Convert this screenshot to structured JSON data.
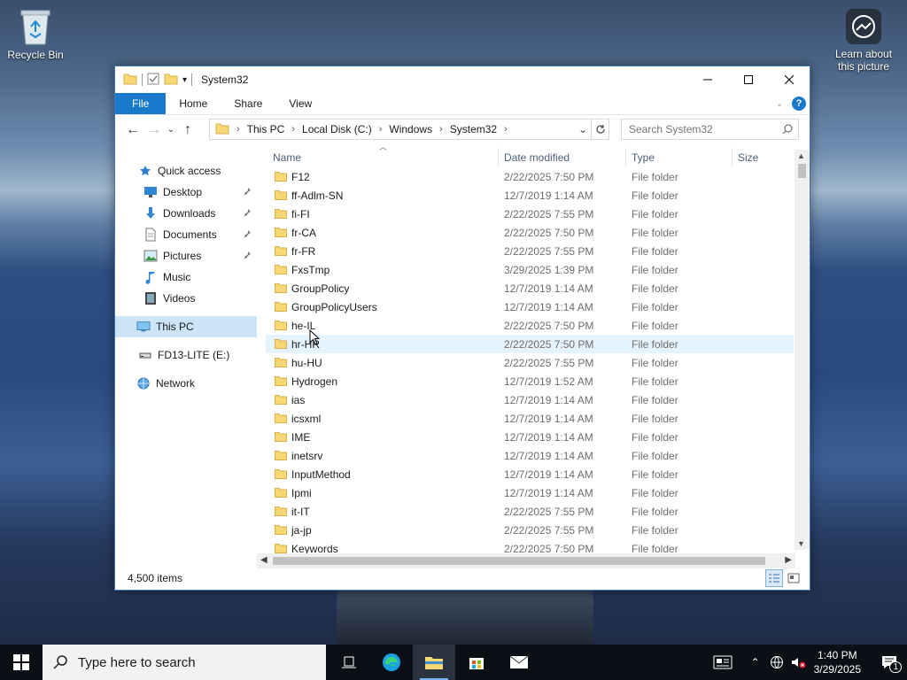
{
  "desktop": {
    "recycle_bin": "Recycle Bin",
    "learn_line1": "Learn about",
    "learn_line2": "this picture"
  },
  "window": {
    "title": "System32",
    "ribbon_tabs": [
      "File",
      "Home",
      "Share",
      "View"
    ],
    "address": {
      "crumbs": [
        "This PC",
        "Local Disk (C:)",
        "Windows",
        "System32"
      ]
    },
    "search_placeholder": "Search System32"
  },
  "nav_pane": {
    "quick_access": "Quick access",
    "items": [
      {
        "label": "Desktop",
        "icon": "desktop-icon",
        "pinned": true
      },
      {
        "label": "Downloads",
        "icon": "download-icon",
        "pinned": true
      },
      {
        "label": "Documents",
        "icon": "documents-icon",
        "pinned": true
      },
      {
        "label": "Pictures",
        "icon": "pictures-icon",
        "pinned": true
      },
      {
        "label": "Music",
        "icon": "music-icon",
        "pinned": false
      },
      {
        "label": "Videos",
        "icon": "videos-icon",
        "pinned": false
      }
    ],
    "this_pc": "This PC",
    "drive": "FD13-LITE (E:)",
    "network": "Network"
  },
  "columns": {
    "name": "Name",
    "date": "Date modified",
    "type": "Type",
    "size": "Size"
  },
  "files": [
    {
      "name": "F12",
      "date": "2/22/2025 7:50 PM",
      "type": "File folder"
    },
    {
      "name": "ff-Adlm-SN",
      "date": "12/7/2019 1:14 AM",
      "type": "File folder"
    },
    {
      "name": "fi-FI",
      "date": "2/22/2025 7:55 PM",
      "type": "File folder"
    },
    {
      "name": "fr-CA",
      "date": "2/22/2025 7:50 PM",
      "type": "File folder"
    },
    {
      "name": "fr-FR",
      "date": "2/22/2025 7:55 PM",
      "type": "File folder"
    },
    {
      "name": "FxsTmp",
      "date": "3/29/2025 1:39 PM",
      "type": "File folder"
    },
    {
      "name": "GroupPolicy",
      "date": "12/7/2019 1:14 AM",
      "type": "File folder"
    },
    {
      "name": "GroupPolicyUsers",
      "date": "12/7/2019 1:14 AM",
      "type": "File folder"
    },
    {
      "name": "he-IL",
      "date": "2/22/2025 7:50 PM",
      "type": "File folder"
    },
    {
      "name": "hr-HR",
      "date": "2/22/2025 7:50 PM",
      "type": "File folder"
    },
    {
      "name": "hu-HU",
      "date": "2/22/2025 7:55 PM",
      "type": "File folder"
    },
    {
      "name": "Hydrogen",
      "date": "12/7/2019 1:52 AM",
      "type": "File folder"
    },
    {
      "name": "ias",
      "date": "12/7/2019 1:14 AM",
      "type": "File folder"
    },
    {
      "name": "icsxml",
      "date": "12/7/2019 1:14 AM",
      "type": "File folder"
    },
    {
      "name": "IME",
      "date": "12/7/2019 1:14 AM",
      "type": "File folder"
    },
    {
      "name": "inetsrv",
      "date": "12/7/2019 1:14 AM",
      "type": "File folder"
    },
    {
      "name": "InputMethod",
      "date": "12/7/2019 1:14 AM",
      "type": "File folder"
    },
    {
      "name": "Ipmi",
      "date": "12/7/2019 1:14 AM",
      "type": "File folder"
    },
    {
      "name": "it-IT",
      "date": "2/22/2025 7:55 PM",
      "type": "File folder"
    },
    {
      "name": "ja-jp",
      "date": "2/22/2025 7:55 PM",
      "type": "File folder"
    },
    {
      "name": "Keywords",
      "date": "2/22/2025 7:50 PM",
      "type": "File folder"
    }
  ],
  "hovered_row": 9,
  "status": {
    "item_count": "4,500 items"
  },
  "taskbar": {
    "search_placeholder": "Type here to search",
    "time": "1:40 PM",
    "date": "3/29/2025",
    "notification_count": "1"
  },
  "colors": {
    "accent": "#1979ca",
    "folder": "#f8d775",
    "selection": "#cce4f7",
    "hover": "#e5f3ff"
  }
}
